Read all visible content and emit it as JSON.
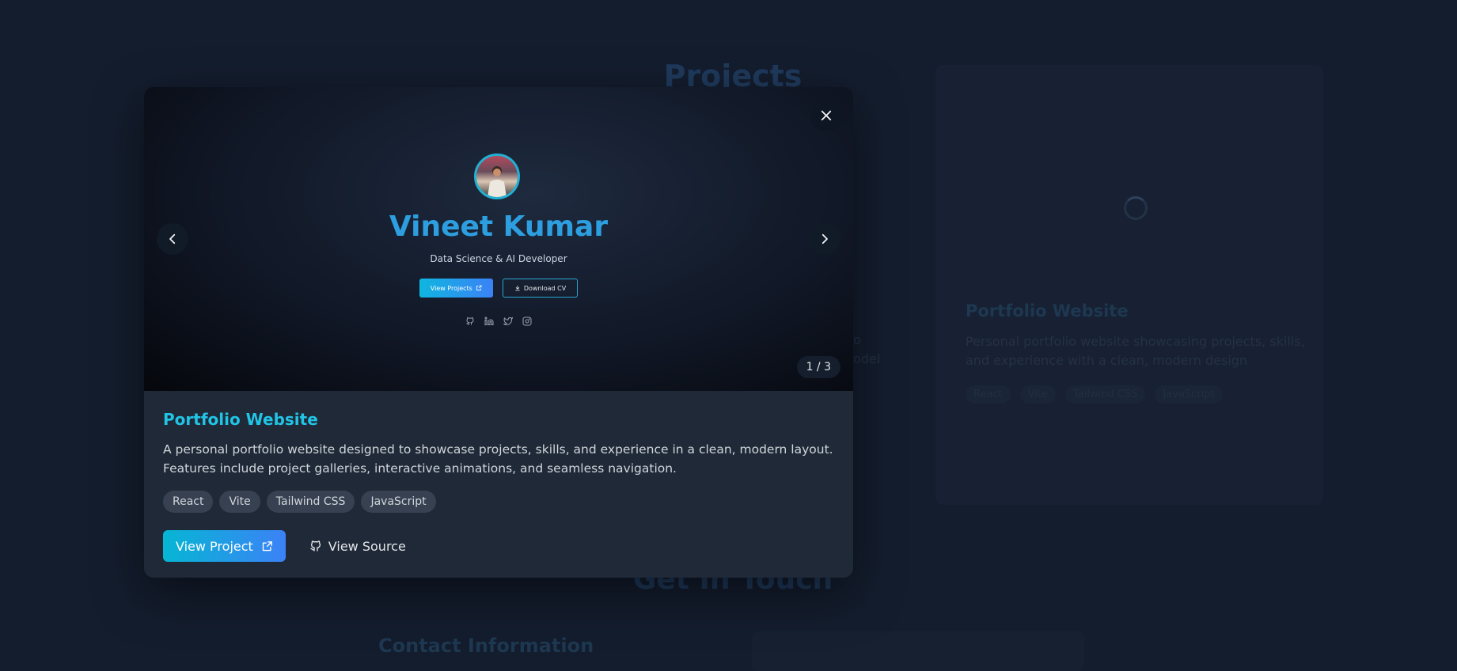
{
  "background": {
    "section_title": "Projects",
    "card": {
      "title": "Portfolio Website",
      "description": "Personal portfolio website showcasing projects, skills, and experience with a clean, modern design",
      "tags": [
        "React",
        "Vite",
        "Tailwind CSS",
        "JavaScript"
      ]
    },
    "fragment_1": "o",
    "fragment_2": "odel",
    "contact_heading": "Get In Touch",
    "contact_info_heading": "Contact Information"
  },
  "modal": {
    "gallery": {
      "counter": "1 / 3",
      "preview": {
        "name": "Vineet Kumar",
        "role": "Data Science & AI Developer",
        "view_projects_label": "View Projects",
        "download_cv_label": "Download CV"
      }
    },
    "project": {
      "title": "Portfolio Website",
      "description": "A personal portfolio website designed to showcase projects, skills, and experience in a clean, modern layout. Features include project galleries, interactive animations, and seamless navigation.",
      "tags": [
        "React",
        "Vite",
        "Tailwind CSS",
        "JavaScript"
      ],
      "view_project_label": "View Project",
      "view_source_label": "View Source"
    }
  },
  "colors": {
    "accent": "#22c4e6",
    "gradient_start": "#06b6d4",
    "gradient_end": "#3b82f6",
    "modal_bg": "#1f2937",
    "page_bg": "#141d2e"
  },
  "icons": {
    "close": "close-icon",
    "prev": "chevron-left-icon",
    "next": "chevron-right-icon",
    "external": "external-link-icon",
    "github": "github-icon"
  }
}
